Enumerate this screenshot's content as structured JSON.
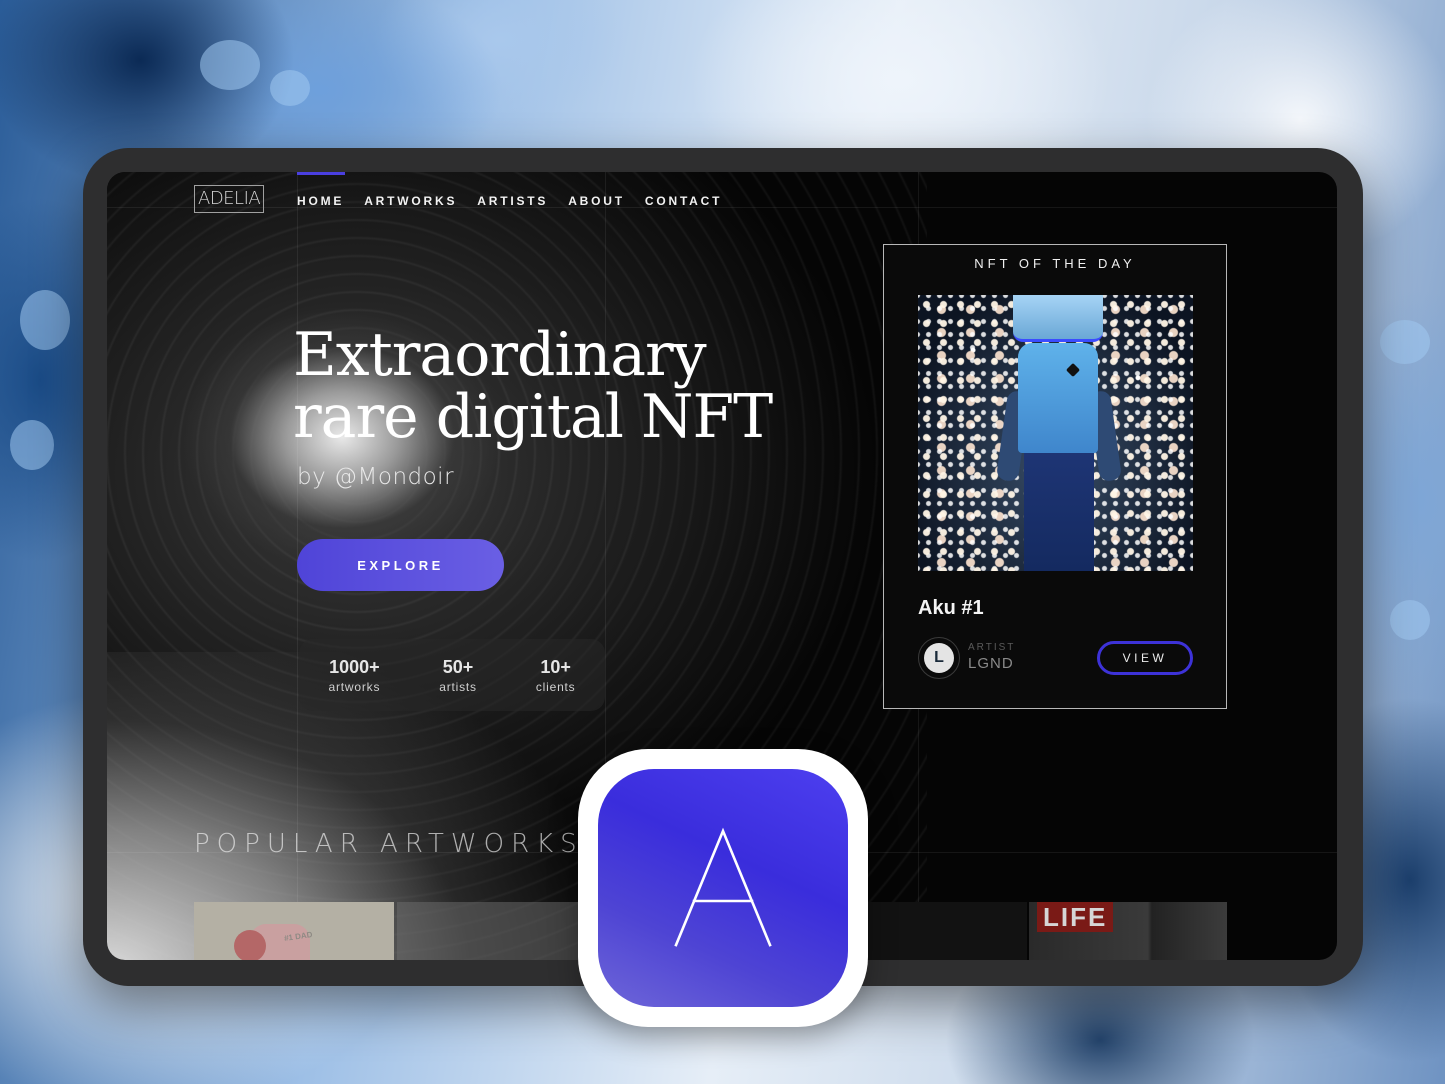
{
  "app": {
    "logo_text": "ADELIA",
    "accent_color": "#4a3fe0"
  },
  "nav": {
    "items": [
      {
        "label": "HOME",
        "active": true
      },
      {
        "label": "ARTWORKS",
        "active": false
      },
      {
        "label": "ARTISTS",
        "active": false
      },
      {
        "label": "ABOUT",
        "active": false
      },
      {
        "label": "CONTACT",
        "active": false
      }
    ]
  },
  "hero": {
    "title_line1": "Extraordinary",
    "title_line2": "rare digital NFT",
    "byline": "by @Mondoir",
    "explore_label": "EXPLORE"
  },
  "stats": [
    {
      "value": "1000+",
      "label": "artworks"
    },
    {
      "value": "50+",
      "label": "artists"
    },
    {
      "value": "10+",
      "label": "clients"
    }
  ],
  "nft_of_the_day": {
    "heading": "NFT OF THE DAY",
    "name": "Aku #1",
    "artist_label": "ARTIST",
    "artist_name": "LGND",
    "artist_avatar_letter": "L",
    "view_label": "VIEW"
  },
  "popular": {
    "title": "POPULAR ARTWORKS",
    "thumbnails": [
      {
        "caption": "#1 DAD"
      },
      {
        "caption": ""
      },
      {
        "caption": ""
      },
      {
        "caption": "LIFE"
      }
    ]
  },
  "app_icon": {
    "letter": "A"
  }
}
